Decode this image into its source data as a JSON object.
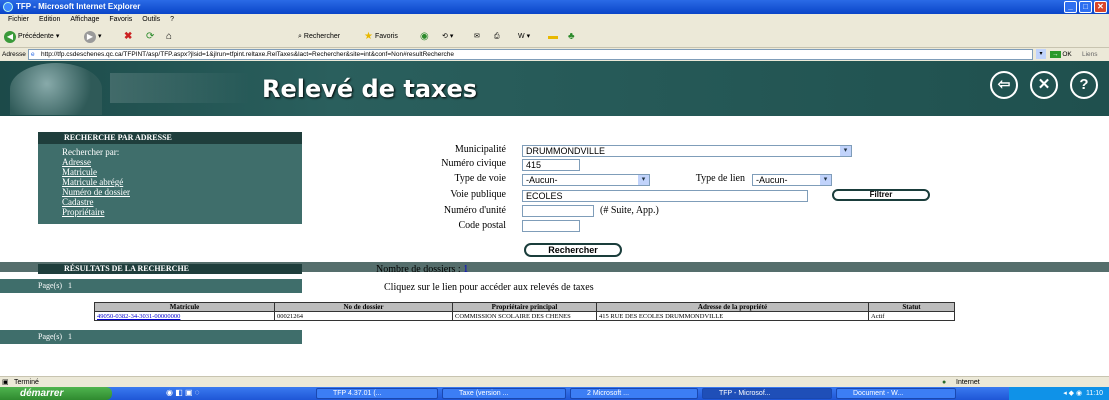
{
  "window": {
    "title": "TFP - Microsoft Internet Explorer",
    "minimize": "_",
    "maximize": "□",
    "close": "✕"
  },
  "menu": [
    "Fichier",
    "Edition",
    "Affichage",
    "Favoris",
    "Outils",
    "?"
  ],
  "toolbar": {
    "back": "Précédente",
    "search": "Rechercher",
    "favorites": "Favoris"
  },
  "address": {
    "label": "Adresse",
    "url": "http://tfp.csdeschenes.qc.ca/TFPINT/asp/TFP.aspx?jlsid=1&jlrun=tfpint.reltaxe.RelTaxes&lact=Rechercher&site=int&conf=Non#resultRecherche",
    "go": "OK",
    "links": "Liens"
  },
  "banner": {
    "title": "Relevé de taxes"
  },
  "left_panel": {
    "header": "RECHERCHE PAR ADRESSE",
    "search_by": "Rechercher par:",
    "links": [
      "Adresse",
      "Matricule",
      "Matricule abrégé",
      "Numéro de dossier",
      "Cadastre",
      "Propriétaire"
    ]
  },
  "form": {
    "municipalite_label": "Municipalité",
    "municipalite_value": "DRUMMONDVILLE",
    "numero_label": "Numéro civique",
    "numero_value": "415",
    "type_voie_label": "Type de voie",
    "type_voie_value": "-Aucun-",
    "type_lien_label": "Type de lien",
    "type_lien_value": "-Aucun-",
    "voie_label": "Voie publique",
    "voie_value": "ECOLES",
    "filtrer": "Filtrer",
    "unite_label": "Numéro d'unité",
    "unite_hint": "(# Suite, App.)",
    "unite_value": "",
    "postal_label": "Code postal",
    "postal_value": "",
    "rechercher": "Rechercher"
  },
  "results": {
    "header": "RÉSULTATS DE LA RECHERCHE",
    "count_label": "Nombre de dossiers :",
    "count": "1",
    "pages_label": "Page(s)",
    "pages": "1",
    "hint": "Cliquez sur le lien pour accéder aux relevés de taxes",
    "columns": [
      "Matricule",
      "No de dossier",
      "Propriétaire principal",
      "Adresse de la propriété",
      "Statut"
    ],
    "rows": [
      [
        "49050-0382-34-3031-00000000",
        "00021264",
        "COMMISSION SCOLAIRE DES CHENES",
        "415 RUE DES ECOLES DRUMMONDVILLE",
        "Actif"
      ]
    ]
  },
  "status": {
    "text": "Terminé",
    "zone": "Internet"
  },
  "taskbar": {
    "start": "démarrer",
    "tasks": [
      "TFP 4.37.01 (...",
      "Taxe (version ...",
      "2 Microsoft ...",
      "TFP - Microsof...",
      "Document - W..."
    ],
    "clock": "11:10"
  }
}
